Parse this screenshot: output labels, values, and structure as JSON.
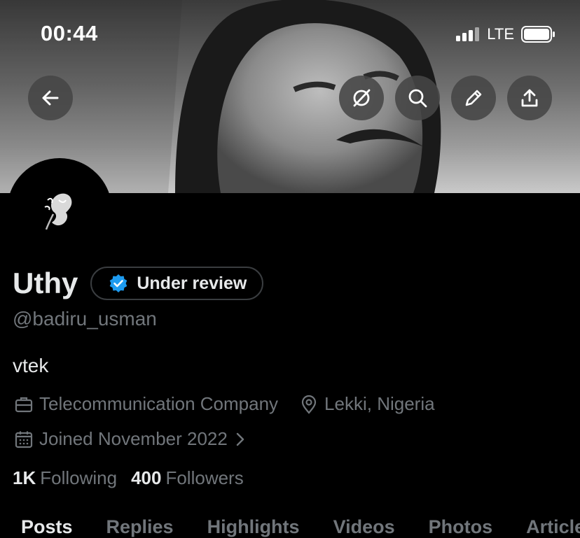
{
  "status_bar": {
    "time": "00:44",
    "network": "LTE"
  },
  "header_actions": [
    {
      "name": "back-button",
      "icon": "arrow-left-icon"
    },
    {
      "name": "grok-button",
      "icon": "slashed-circle-icon"
    },
    {
      "name": "search-button",
      "icon": "search-icon"
    },
    {
      "name": "edit-button",
      "icon": "pencil-icon"
    },
    {
      "name": "share-button",
      "icon": "upload-icon"
    }
  ],
  "profile": {
    "display_name": "Uthy",
    "verification_badge": "Under review",
    "handle": "@badiru_usman",
    "bio": "vtek",
    "category": "Telecommunication Company",
    "location": "Lekki, Nigeria",
    "joined": "Joined November 2022",
    "following_count": "1K",
    "following_label": "Following",
    "followers_count": "400",
    "followers_label": "Followers"
  },
  "tabs": [
    "Posts",
    "Replies",
    "Highlights",
    "Videos",
    "Photos",
    "Articles"
  ],
  "colors": {
    "background": "#000000",
    "text_primary": "#e7e9ea",
    "text_secondary": "#71767b",
    "verified_blue": "#1d9bf0"
  }
}
